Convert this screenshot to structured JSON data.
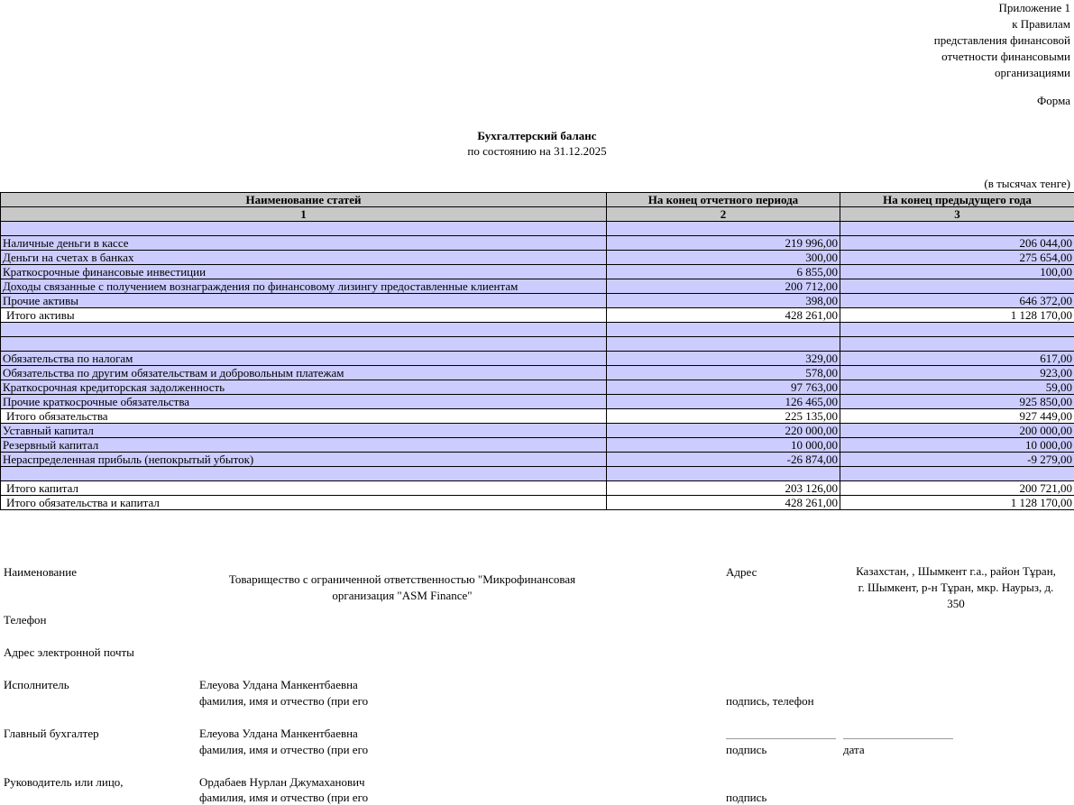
{
  "appendix": {
    "lines": [
      "Приложение 1",
      "к Правилам",
      "представления финансовой",
      "отчетности финансовыми",
      "организациями"
    ],
    "form_label": "Форма"
  },
  "title": "Бухгалтерский баланс",
  "subtitle": "по состоянию на 31.12.2025",
  "units_note": "(в тысячах тенге)",
  "table": {
    "headers": [
      "Наименование статей",
      "На конец отчетного периода",
      "На конец предыдущего года"
    ],
    "header_numbers": [
      "1",
      "2",
      "3"
    ],
    "rows": [
      {
        "name": "",
        "current": "",
        "previous": ""
      },
      {
        "name": "Наличные деньги в кассе",
        "current": "219 996,00",
        "previous": "206 044,00"
      },
      {
        "name": "Деньги на счетах в банках",
        "current": "300,00",
        "previous": "275 654,00"
      },
      {
        "name": "Краткосрочные финансовые инвестиции",
        "current": "6 855,00",
        "previous": "100,00"
      },
      {
        "name": "Доходы связанные с получением вознаграждения по финансовому лизингу предоставленные клиентам",
        "current": "200 712,00",
        "previous": ""
      },
      {
        "name": "Прочие активы",
        "current": "398,00",
        "previous": "646 372,00"
      },
      {
        "name": "Итого активы",
        "current": "428 261,00",
        "previous": "1 128 170,00"
      },
      {
        "name": "",
        "current": "",
        "previous": ""
      },
      {
        "name": "",
        "current": "",
        "previous": ""
      },
      {
        "name": "Обязательства по налогам",
        "current": "329,00",
        "previous": "617,00"
      },
      {
        "name": "Обязательства по другим обязательствам и добровольным платежам",
        "current": "578,00",
        "previous": "923,00"
      },
      {
        "name": "Краткосрочная кредиторская задолженность",
        "current": "97 763,00",
        "previous": "59,00"
      },
      {
        "name": "Прочие краткосрочные обязательства",
        "current": "126 465,00",
        "previous": "925 850,00"
      },
      {
        "name": "Итого обязательства",
        "current": "225 135,00",
        "previous": "927 449,00"
      },
      {
        "name": "Уставный капитал",
        "current": "220 000,00",
        "previous": "200 000,00"
      },
      {
        "name": "Резервный капитал",
        "current": "10 000,00",
        "previous": "10 000,00"
      },
      {
        "name": "Нераспределенная прибыль (непокрытый убыток)",
        "current": "-26 874,00",
        "previous": "-9 279,00"
      },
      {
        "name": "",
        "current": "",
        "previous": ""
      },
      {
        "name": "Итого капитал",
        "current": "203 126,00",
        "previous": "200 721,00"
      },
      {
        "name": "Итого обязательства и капитал",
        "current": "428 261,00",
        "previous": "1 128 170,00"
      }
    ]
  },
  "footer": {
    "name_label": "Наименование",
    "org_name_line1": "Товарищество с ограниченной ответственностью \"Микрофинансовая",
    "org_name_line2": "организация \"ASM Finance\"",
    "address_label": "Адрес",
    "address_line1": "Казахстан, , Шымкент г.а., район Тұран,",
    "address_line2": "г. Шымкент, р-н Тұран, мкр. Наурыз, д.",
    "address_line3": "350",
    "phone_label": "Телефон",
    "email_label": "Адрес электронной почты",
    "executor_label": "Исполнитель",
    "executor_name": "Елеуова Улдана Манкентбаевна",
    "executor_hint": "фамилия, имя и отчество (при его",
    "executor_sign": "подпись, телефон",
    "accountant_label": "Главный бухгалтер",
    "accountant_name": "Елеуова Улдана Манкентбаевна",
    "accountant_hint": "фамилия, имя и отчество (при его",
    "accountant_sign": "подпись",
    "accountant_date": "дата",
    "head_label": "Руководитель или лицо,",
    "head_name": "Ордабаев Нурлан Джумаханович",
    "head_hint": "фамилия, имя и отчество (при его",
    "head_sign": "подпись"
  }
}
